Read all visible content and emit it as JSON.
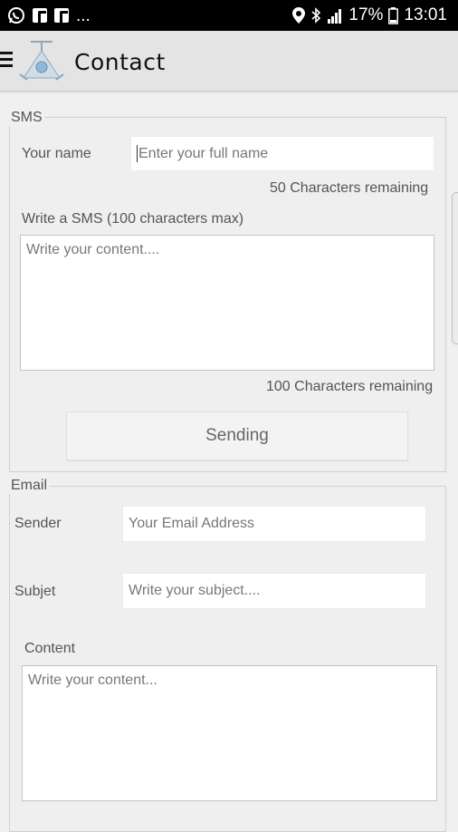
{
  "status_bar": {
    "overflow": "...",
    "battery": "17%",
    "time": "13:01",
    "icons": [
      "whatsapp-icon",
      "facebook-icon",
      "facebook-icon",
      "location-icon",
      "bluetooth-icon",
      "signal-icon",
      "battery-icon"
    ]
  },
  "toolbar": {
    "title": "Contact",
    "menu_icon": "menu-icon",
    "logo": "app-logo"
  },
  "sms": {
    "legend": "SMS",
    "name_label": "Your name",
    "name_placeholder": "Enter your full name",
    "name_remaining": "50 Characters remaining",
    "sms_label": "Write a SMS (100 characters max)",
    "sms_placeholder": "Write your content....",
    "sms_remaining": "100 Characters remaining",
    "send_button": "Sending"
  },
  "email": {
    "legend": "Email",
    "sender_label": "Sender",
    "sender_placeholder": "Your Email Address",
    "subject_label": "Subjet",
    "subject_placeholder": "Write your subject....",
    "content_label": "Content",
    "content_placeholder": "Write your content..."
  },
  "colors": {
    "status_bar_bg": "#000000",
    "toolbar_bg": "#e4e4e4",
    "page_bg": "#f0f0f0",
    "input_bg": "#ffffff"
  }
}
